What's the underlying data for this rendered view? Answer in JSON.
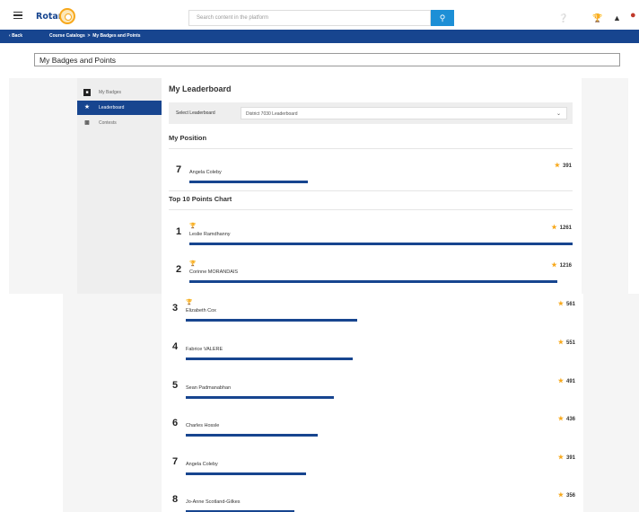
{
  "header": {
    "logo_text": "Rotary",
    "search_placeholder": "Search content in the platform"
  },
  "nav": {
    "back_label": "Back",
    "breadcrumb": [
      "Course Catalogs",
      "My Badges and Points"
    ],
    "separator": ">"
  },
  "page_title": "My Badges and Points",
  "sidebar": {
    "items": [
      {
        "label": "My Badges",
        "icon": "badge-icon",
        "active": false
      },
      {
        "label": "Leaderboard",
        "icon": "star-icon",
        "active": true
      },
      {
        "label": "Contests",
        "icon": "podium-icon",
        "active": false
      }
    ]
  },
  "leaderboard": {
    "heading": "My Leaderboard",
    "select_label": "Select Leaderboard",
    "selected_value": "District 7030 Leaderboard"
  },
  "my_position": {
    "heading": "My Position",
    "rank": "7",
    "name": "Angela Coleby",
    "points": "391",
    "progress": 0.31
  },
  "top10": {
    "heading": "Top 10 Points Chart",
    "rows": [
      {
        "rank": "1",
        "name": "Leslie Ramdhanny",
        "points": "1261",
        "progress": 1.0,
        "trophy": "gold"
      },
      {
        "rank": "2",
        "name": "Corinne MORANDAIS",
        "points": "1216",
        "progress": 0.96,
        "trophy": "silver"
      },
      {
        "rank": "3",
        "name": "Elizabeth Cox",
        "points": "561",
        "progress": 0.44,
        "trophy": "gold"
      },
      {
        "rank": "4",
        "name": "Fabrice VALERE",
        "points": "551",
        "progress": 0.43,
        "trophy": ""
      },
      {
        "rank": "5",
        "name": "Sean Padmanabhan",
        "points": "491",
        "progress": 0.38,
        "trophy": ""
      },
      {
        "rank": "6",
        "name": "Charles Hossle",
        "points": "436",
        "progress": 0.34,
        "trophy": ""
      },
      {
        "rank": "7",
        "name": "Angela Coleby",
        "points": "391",
        "progress": 0.31,
        "trophy": ""
      },
      {
        "rank": "8",
        "name": "Jo-Anne Scotland-Gilkes",
        "points": "356",
        "progress": 0.28,
        "trophy": ""
      }
    ]
  },
  "colors": {
    "primary": "#17458f",
    "accent": "#f7a81b",
    "search_button": "#1d8fd6"
  }
}
